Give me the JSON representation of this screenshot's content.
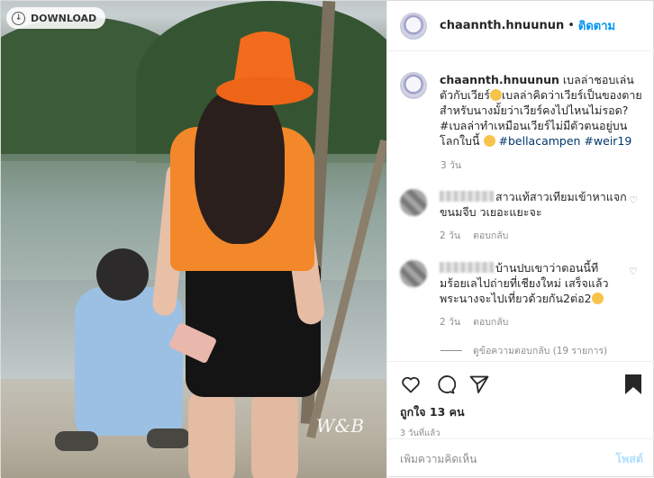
{
  "photo": {
    "download_label": "DOWNLOAD",
    "watermark": "W&B"
  },
  "header": {
    "username": "chaannth.hnuunun",
    "dot": "•",
    "follow_label": "ติดตาม"
  },
  "caption": {
    "username": "chaannth.hnuunun",
    "text_1": "เบลล่าชอบเล่นตัวกับเวียร์",
    "text_2": "เบลล่าคิดว่าเวียร์เป็นของตายสำหรับนางมั้ยว่าเวียร์คงไปไหนไม่รอด?#เบลล่าทำเหมือนเวียร์ไม่มีตัวตนอยู่บนโลกใบนี้",
    "hashtags": "#bellacampen #weir19",
    "time": "3 วัน"
  },
  "comments": [
    {
      "text": "สาวแท้สาวเทียมเข้าหาแจกขนมจีบ วเยอะแยะจะ",
      "time": "2 วัน",
      "reply_label": "ตอบกลับ"
    },
    {
      "text": "บ้านปบเขาว่าตอนนี้ทีมร้อยเลไปถ่ายที่เชียงใหม่ เสร็จแล้วพระนางจะไปเที่ยวด้วยกัน2ต่อ2",
      "time": "2 วัน",
      "reply_label": "ตอบกลับ"
    }
  ],
  "view_replies": "ดูข้อความตอบกลับ (19 รายการ)",
  "likes": "ถูกใจ 13 คน",
  "posted": "3 วันที่แล้ว",
  "add_comment": {
    "placeholder": "เพิ่มความคิดเห็น",
    "post_label": "โพสต์"
  },
  "colors": {
    "link": "#0095f6",
    "hashtag": "#00376b",
    "muted": "#8e8e8e",
    "hat": "#f36c1d",
    "top": "#f2882a"
  }
}
